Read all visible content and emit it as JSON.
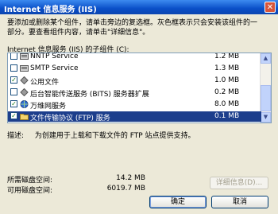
{
  "window": {
    "title": "Internet 信息服务 (IIS)",
    "close_symbol": "✕"
  },
  "instructions": [
    "要添加或删除某个组件，请单击旁边的复选框。灰色框表示只会安装该组件的一",
    "部分。要查看组件内容，请单击\"详细信息\"。"
  ],
  "subcomponents_label": "Internet 信息服务 (IIS) 的子组件 (C):",
  "components": [
    {
      "checked": false,
      "partial": false,
      "icon": "service-icon",
      "label": "NNTP Service",
      "size": "1.2 MB",
      "selected": false
    },
    {
      "checked": false,
      "partial": false,
      "icon": "service-icon",
      "label": "SMTP Service",
      "size": "1.3 MB",
      "selected": false
    },
    {
      "checked": true,
      "partial": false,
      "icon": "diamond-icon",
      "label": "公用文件",
      "size": "1.0 MB",
      "selected": false
    },
    {
      "checked": false,
      "partial": false,
      "icon": "diamond-icon",
      "label": "后台智能传送服务 (BITS) 服务器扩展",
      "size": "0.2 MB",
      "selected": false
    },
    {
      "checked": true,
      "partial": false,
      "icon": "globe-icon",
      "label": "万维网服务",
      "size": "8.0 MB",
      "selected": false
    },
    {
      "checked": true,
      "partial": false,
      "icon": "folder-icon",
      "label": "文件传输协议 (FTP) 服务",
      "size": "0.1 MB",
      "selected": true
    }
  ],
  "description": {
    "label": "描述:",
    "text": "为创建用于上载和下载文件的 FTP 站点提供支持。"
  },
  "disk": {
    "required_label": "所需磁盘空间:",
    "required_value": "14.2 MB",
    "available_label": "可用磁盘空间:",
    "available_value": "6019.7 MB"
  },
  "buttons": {
    "details": "详细信息(D)...",
    "ok": "确定",
    "cancel": "取消"
  },
  "scrollbar": {
    "up": "▲",
    "down": "▼"
  }
}
